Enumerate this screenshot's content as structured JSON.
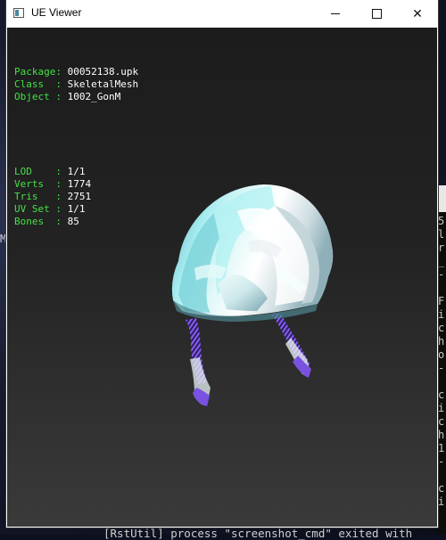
{
  "window": {
    "title": "UE Viewer",
    "controls": {
      "minimize": "—",
      "maximize": "☐",
      "close": "✕"
    }
  },
  "info": {
    "group1": [
      {
        "key": "Package",
        "value": "00052138.upk"
      },
      {
        "key": "Class  ",
        "value": "SkeletalMesh"
      },
      {
        "key": "Object ",
        "value": "1002_GonM"
      }
    ],
    "group2": [
      {
        "key": "LOD    ",
        "value": "1/1"
      },
      {
        "key": "Verts  ",
        "value": "1774"
      },
      {
        "key": "Tris   ",
        "value": "2751"
      },
      {
        "key": "UV Set ",
        "value": "1/1"
      },
      {
        "key": "Bones  ",
        "value": "85"
      }
    ]
  },
  "background": {
    "left_edge_text": "M",
    "console_lines": [
      "5",
      "l",
      "r",
      "_",
      "-",
      "",
      "F",
      "i",
      "c",
      "h",
      "o",
      "-",
      "",
      "c",
      "i",
      "c",
      "h",
      "1",
      "-",
      "",
      "c",
      "i"
    ],
    "bottom_command": "[RstUtil] process \"screenshot_cmd\" exited with"
  },
  "colors": {
    "info_key": "#46e046",
    "info_value": "#ffffff",
    "mesh_cyan": "#9fe8ee",
    "mesh_white": "#eef4f6",
    "legs": "#7a52e0"
  },
  "icons": [
    "app-icon",
    "minimize-icon",
    "maximize-icon",
    "close-icon"
  ]
}
